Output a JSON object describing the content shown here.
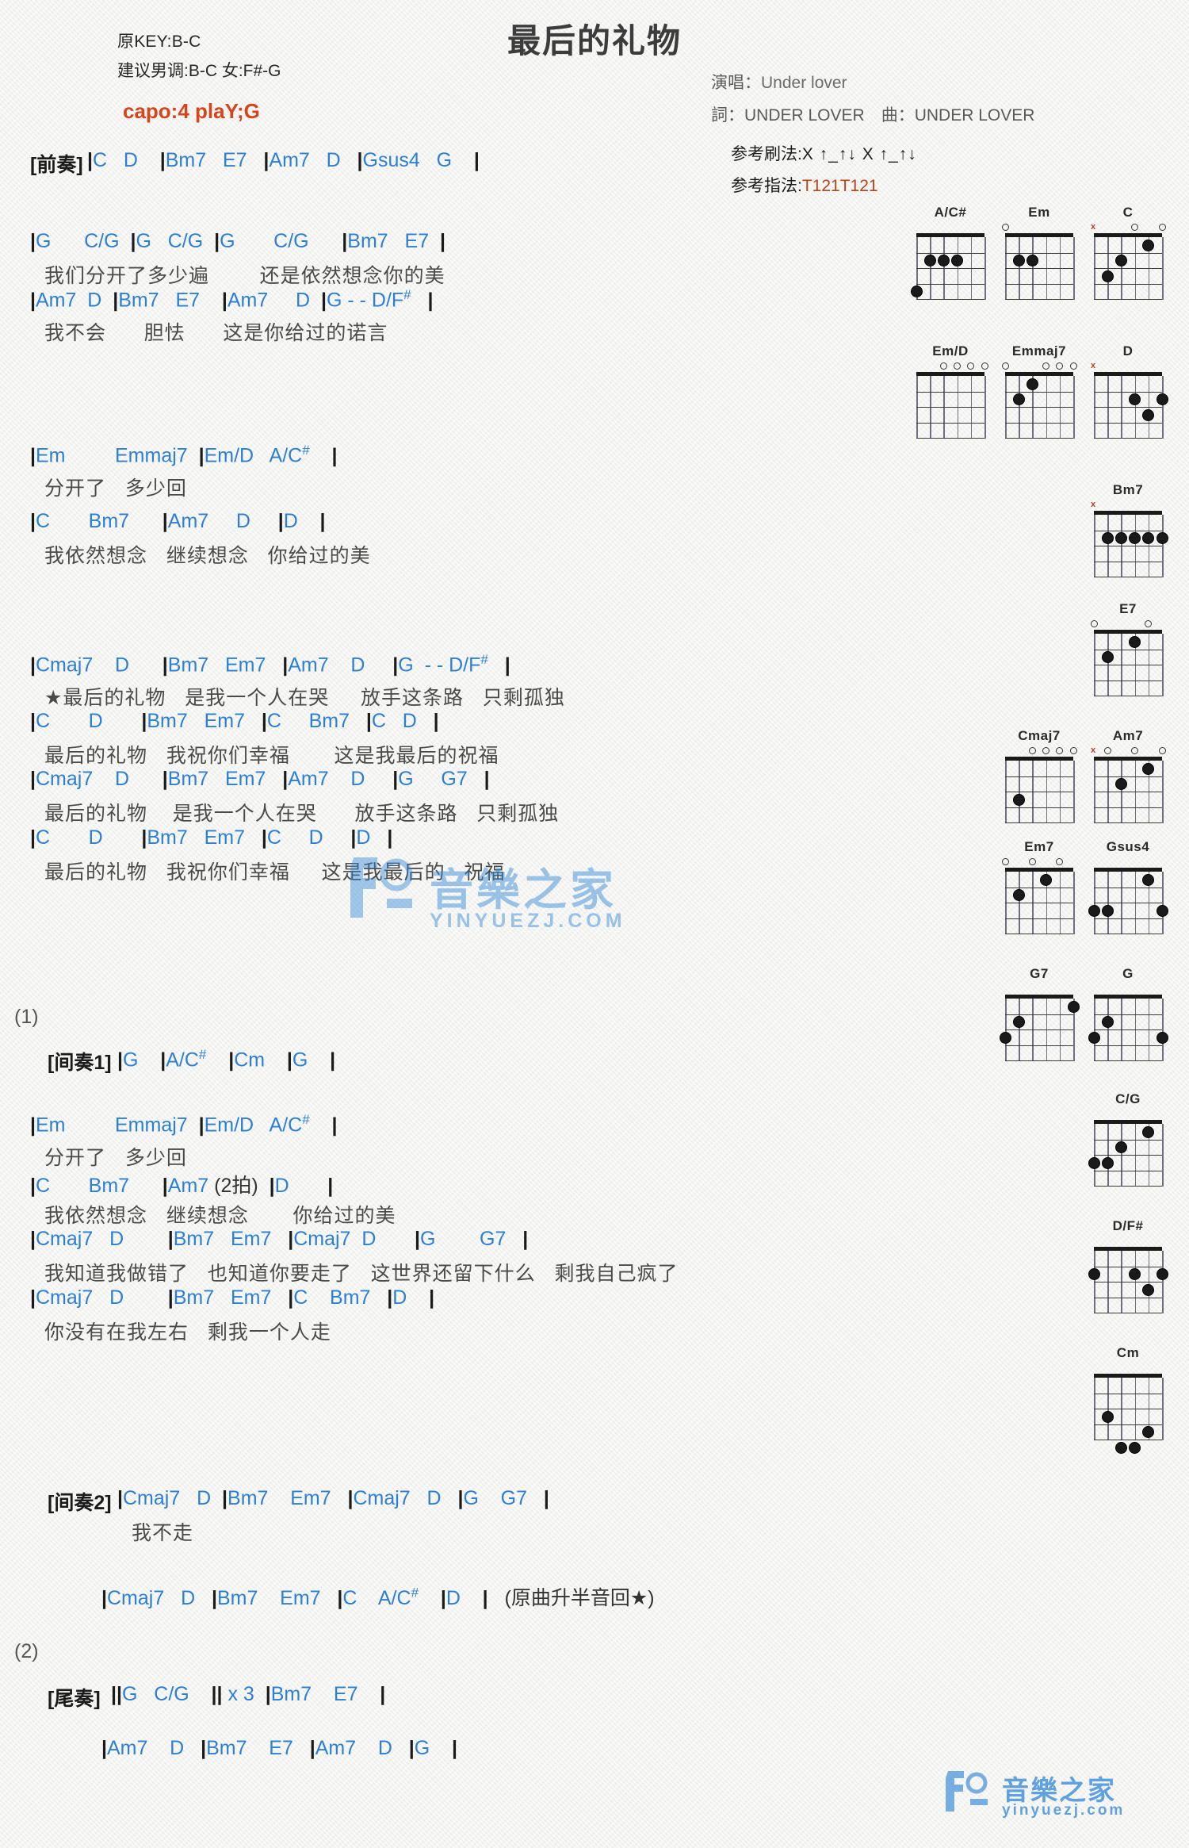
{
  "header": {
    "orig_key": "原KEY:B-C",
    "suggest": "建议男调:B-C 女:F#-G",
    "capo": "capo:4 plaY;G",
    "title": "最后的礼物",
    "singer_label": "演唱：",
    "singer": "Under lover",
    "credits": "詞：UNDER LOVER　曲：UNDER LOVER",
    "strum_label": "参考刷法:",
    "strum_pattern": "X ↑_↑↓ X ↑_↑↓",
    "finger_label": "参考指法:",
    "finger_pattern": "T121T121"
  },
  "sections": [
    {
      "tag": "[前奏]",
      "chords": "|C   D    |Bm7   E7   |Am7   D   |Gsus4   G    |",
      "lyric": ""
    },
    {
      "tag": "",
      "chords": "|G      C/G  |G   C/G  |G       C/G      |Bm7   E7  |",
      "lyric": "我们分开了多少遍        还是依然想念你的美"
    },
    {
      "tag": "",
      "chords": "|Am7  D  |Bm7   E7    |Am7     D  |G - - D/F#   |",
      "lyric": "我不会      胆怯      这是你给过的诺言"
    },
    {
      "tag": "",
      "chords": "|Em         Emmaj7  |Em/D   A/C#    |",
      "lyric": "分开了   多少回"
    },
    {
      "tag": "",
      "chords": "|C       Bm7      |Am7     D     |D    |",
      "lyric": "我依然想念   继续想念   你给过的美"
    },
    {
      "tag": "",
      "chords": "|Cmaj7    D      |Bm7   Em7   |Am7    D     |G  - - D/F#   |",
      "lyric": "★最后的礼物   是我一个人在哭     放手这条路   只剩孤独"
    },
    {
      "tag": "",
      "chords": "|C       D       |Bm7   Em7   |C     Bm7   |C   D   |",
      "lyric": "最后的礼物   我祝你们幸福       这是我最后的祝福"
    },
    {
      "tag": "",
      "chords": "|Cmaj7    D      |Bm7   Em7   |Am7    D     |G     G7   |",
      "lyric": "最后的礼物    是我一个人在哭      放手这条路   只剩孤独"
    },
    {
      "tag": "",
      "chords": "|C       D       |Bm7   Em7   |C     D     |D   |",
      "lyric": "最后的礼物   我祝你们幸福     这是我最后的   祝福"
    },
    {
      "tag": "[间奏1]",
      "chords": "|G    |A/C#    |Cm    |G    |",
      "lyric": ""
    },
    {
      "tag": "",
      "chords": "|Em         Emmaj7  |Em/D   A/C#    |",
      "lyric": "分开了   多少回"
    },
    {
      "tag": "",
      "chords": "|C       Bm7      |Am7 (2拍)  |D       |",
      "lyric": "我依然想念   继续想念       你给过的美"
    },
    {
      "tag": "",
      "chords": "|Cmaj7   D        |Bm7   Em7   |Cmaj7  D       |G        G7   |",
      "lyric": "我知道我做错了   也知道你要走了   这世界还留下什么   剩我自己疯了"
    },
    {
      "tag": "",
      "chords": "|Cmaj7   D        |Bm7   Em7   |C    Bm7   |D    |",
      "lyric": "你没有在我左右   剩我一个人走"
    },
    {
      "tag": "[间奏2]",
      "chords": "|Cmaj7   D  |Bm7    Em7   |Cmaj7   D   |G    G7   |",
      "lyric": "我不走"
    },
    {
      "tag": "",
      "chords": "|Cmaj7   D   |Bm7    Em7   |C    A/C#    |D    |   (原曲升半音回★)",
      "lyric": ""
    },
    {
      "tag": "[尾奏]",
      "chords": "||G   C/G    || x 3  |Bm7    E7    |",
      "lyric": ""
    },
    {
      "tag": "",
      "chords": "|Am7    D   |Bm7    E7   |Am7    D   |G    |",
      "lyric": ""
    }
  ],
  "markers": {
    "repeat1": "(1)",
    "repeat2": "(2)"
  },
  "chord_diagrams": [
    {
      "name": "A/C#",
      "open": [],
      "x": [],
      "dots": [
        [
          5,
          2
        ],
        [
          4,
          2
        ],
        [
          3,
          2
        ],
        [
          6,
          4
        ]
      ],
      "base": ""
    },
    {
      "name": "Em",
      "open": [
        6
      ],
      "x": [],
      "dots": [
        [
          5,
          2
        ],
        [
          4,
          2
        ]
      ],
      "base": ""
    },
    {
      "name": "C",
      "open": [
        3,
        1
      ],
      "x": [
        6
      ],
      "dots": [
        [
          2,
          1
        ],
        [
          4,
          2
        ],
        [
          5,
          3
        ]
      ],
      "base": ""
    },
    {
      "name": "Em/D",
      "open": [
        4,
        3,
        2,
        1
      ],
      "x": [],
      "dots": [],
      "base": ""
    },
    {
      "name": "Emmaj7",
      "open": [
        6,
        3,
        2,
        1
      ],
      "x": [],
      "dots": [
        [
          4,
          1
        ],
        [
          5,
          2
        ]
      ],
      "base": ""
    },
    {
      "name": "D",
      "open": [],
      "x": [
        6
      ],
      "dots": [
        [
          3,
          2
        ],
        [
          1,
          2
        ],
        [
          2,
          3
        ]
      ],
      "base": ""
    },
    {
      "name": "Bm7",
      "open": [],
      "x": [
        6
      ],
      "dots": [
        [
          5,
          2
        ],
        [
          4,
          2
        ],
        [
          3,
          2
        ],
        [
          2,
          2
        ],
        [
          1,
          2
        ]
      ],
      "base": ""
    },
    {
      "name": "E7",
      "open": [
        6,
        2
      ],
      "x": [],
      "dots": [
        [
          5,
          2
        ],
        [
          3,
          1
        ]
      ],
      "base": ""
    },
    {
      "name": "Cmaj7",
      "open": [
        4,
        3,
        2,
        1
      ],
      "x": [],
      "dots": [
        [
          5,
          3
        ]
      ],
      "base": ""
    },
    {
      "name": "Am7",
      "open": [
        5,
        3,
        1
      ],
      "x": [
        6
      ],
      "dots": [
        [
          4,
          2
        ],
        [
          2,
          1
        ]
      ],
      "base": ""
    },
    {
      "name": "Em7",
      "open": [
        6,
        4,
        2
      ],
      "x": [],
      "dots": [
        [
          5,
          2
        ],
        [
          3,
          1
        ]
      ],
      "base": ""
    },
    {
      "name": "Gsus4",
      "open": [],
      "x": [],
      "dots": [
        [
          6,
          3
        ],
        [
          5,
          3
        ],
        [
          2,
          1
        ],
        [
          1,
          3
        ]
      ],
      "base": ""
    },
    {
      "name": "G7",
      "open": [],
      "x": [],
      "dots": [
        [
          6,
          3
        ],
        [
          5,
          2
        ],
        [
          1,
          1
        ]
      ],
      "base": ""
    },
    {
      "name": "G",
      "open": [],
      "x": [],
      "dots": [
        [
          6,
          3
        ],
        [
          5,
          2
        ],
        [
          1,
          3
        ]
      ],
      "base": ""
    },
    {
      "name": "C/G",
      "open": [],
      "x": [],
      "dots": [
        [
          6,
          3
        ],
        [
          4,
          2
        ],
        [
          5,
          3
        ],
        [
          2,
          1
        ]
      ],
      "base": ""
    },
    {
      "name": "D/F#",
      "open": [],
      "x": [],
      "dots": [
        [
          6,
          2
        ],
        [
          3,
          2
        ],
        [
          1,
          2
        ],
        [
          2,
          3
        ]
      ],
      "base": ""
    },
    {
      "name": "Cm",
      "open": [],
      "x": [],
      "dots": [
        [
          5,
          3
        ],
        [
          4,
          5
        ],
        [
          3,
          5
        ],
        [
          2,
          4
        ]
      ],
      "base": ""
    }
  ],
  "watermark": {
    "main_text": "音樂之家",
    "main_sub": "YINYUEZJ.COM",
    "corner_text": "音樂之家",
    "corner_sub": "yinyuezj.com",
    "color": "#2f86d6"
  }
}
